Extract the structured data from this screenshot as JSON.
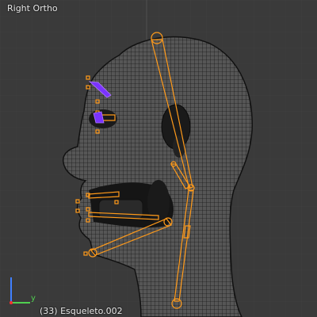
{
  "viewport": {
    "view_name": "Right Ortho",
    "object_info": "(33) Esqueleto.002"
  },
  "axis_gizmo": {
    "x_color": "#ff3030",
    "y_color": "#50d050",
    "z_color": "#4080ff",
    "y_label": "y"
  },
  "colors": {
    "background": "#3a3a3a",
    "mesh_wire": "#111111",
    "bone_selected": "#ff9a1a",
    "bone_active": "#7a33ff"
  }
}
